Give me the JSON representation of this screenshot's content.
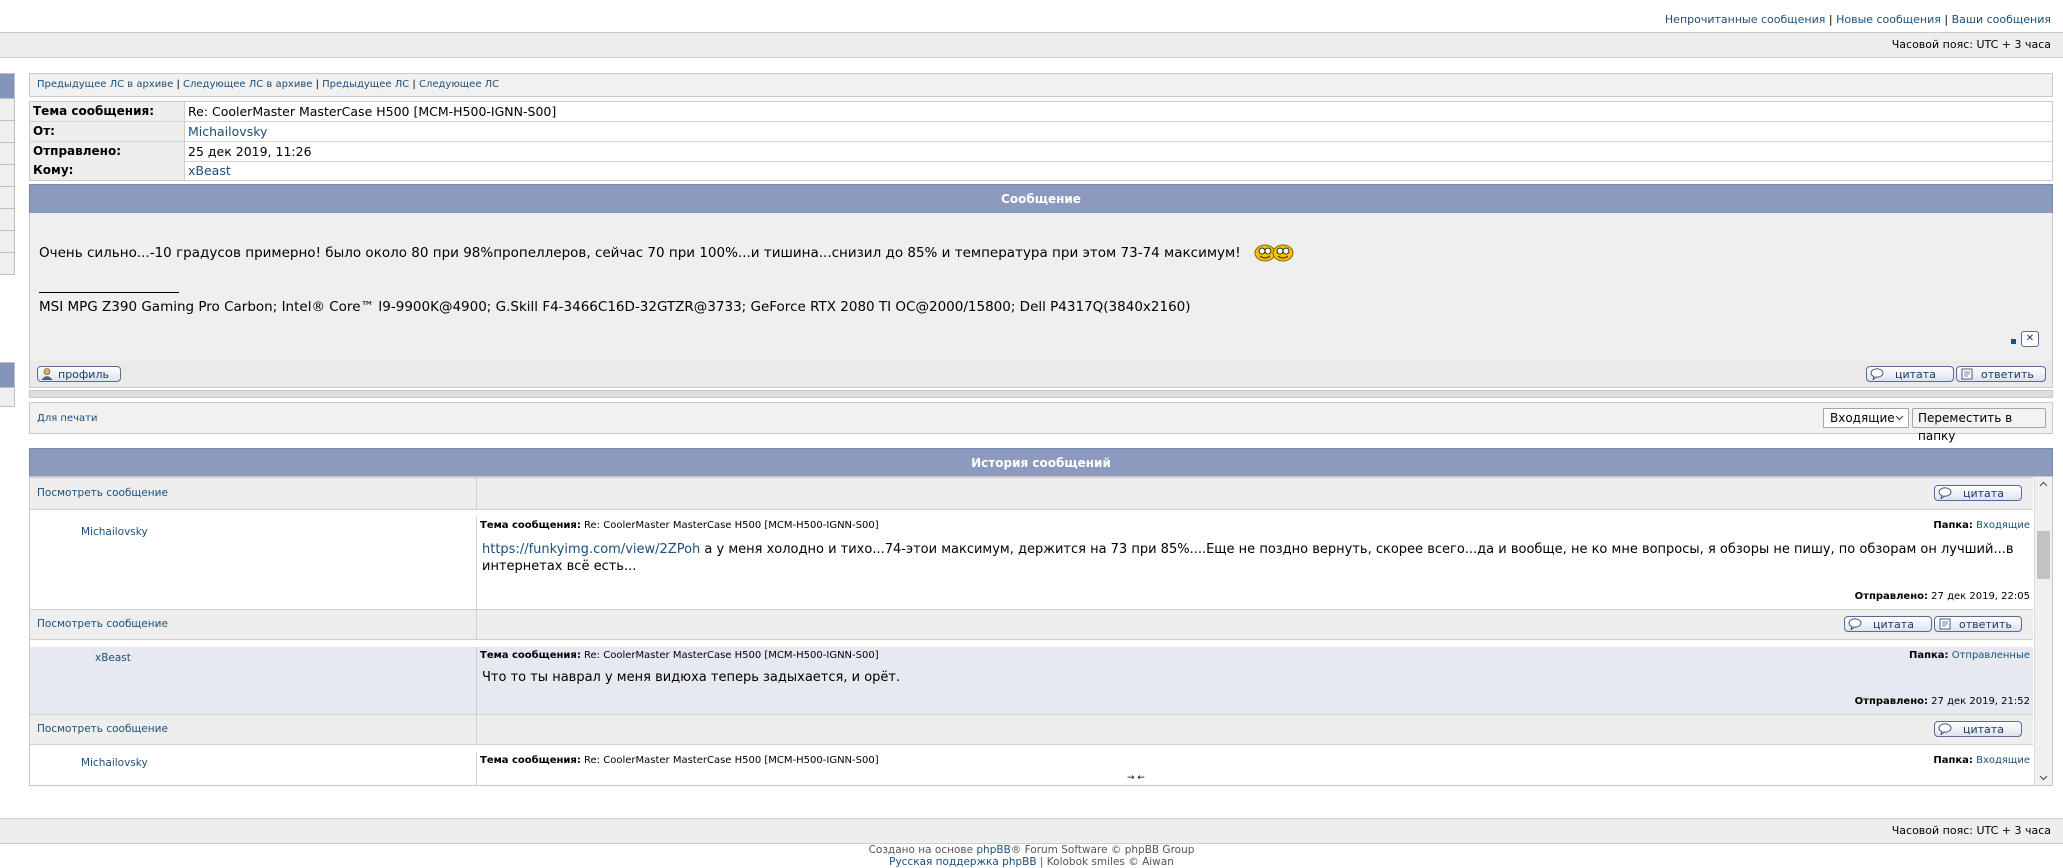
{
  "top": {
    "unread": "Непрочитанные сообщения",
    "new": "Новые сообщения",
    "yours": "Ваши сообщения",
    "sep": "|",
    "timezone": "Часовой пояс: UTC + 3 часа"
  },
  "pm_nav": {
    "prev_archive": "Предыдущее ЛС в архиве",
    "next_archive": "Следующее ЛС в архиве",
    "prev": "Предыдущее ЛС",
    "next": "Следующее ЛС",
    "sep": "|"
  },
  "header": {
    "subject_label": "Тема сообщения:",
    "subject": "Re: CoolerMaster MasterCase H500 [MCM-H500-IGNN-S00]",
    "from_label": "От:",
    "from": "Michailovsky",
    "sent_label": "Отправлено:",
    "sent": "25 дек 2019, 11:26",
    "to_label": "Кому:",
    "to": "xBeast"
  },
  "message": {
    "title": "Сообщение",
    "body": "Очень сильно...-10 градусов примерно! было около 80 при 98%пропеллеров, сейчас 70 при 100%...и тишина...снизил до 85% и температура при этом 73-74 максимум!",
    "signature": "MSI MPG Z390 Gaming Pro Carbon; Intel® Core™ I9-9900K@4900; G.Skill F4-3466C16D-32GTZR@3733; GeForce RTX 2080 TI OC@2000/15800; Dell P4317Q(3840x2160)",
    "close_glyph": "✕",
    "smiley": "laughing-smiley-icon"
  },
  "buttons": {
    "profile": "профиль",
    "quote": "цитата",
    "reply": "ответить"
  },
  "print_row": {
    "print": "Для печати",
    "folder_select": "Входящие",
    "move": "Переместить в папку"
  },
  "history": {
    "title": "История сообщений",
    "view": "Посмотреть сообщение",
    "subject_label": "Тема сообщения:",
    "folder_label": "Папка:",
    "sent_label": "Отправлено:",
    "entries": [
      {
        "author": "Michailovsky",
        "subject": "Re: CoolerMaster MasterCase H500 [MCM-H500-IGNN-S00]",
        "folder": "Входящие",
        "link": "https://funkyimg.com/view/2ZPoh",
        "body": " а у меня холодно и тихо...74-этои максимум, держится на 73 при 85%....Еще не поздно вернуть, скорее всего...да и вообще, не ко мне вопросы, я обзоры не пишу, по обзорам он лучший...в интернетах всё есть...",
        "sent": "27 дек 2019, 22:05"
      },
      {
        "author": "xBeast",
        "subject": "Re: CoolerMaster MasterCase H500 [MCM-H500-IGNN-S00]",
        "folder": "Отправленные",
        "body": "Что то ты наврал у меня видюха теперь задыхается, и орёт.",
        "sent": "27 дек 2019, 21:52"
      },
      {
        "author": "Michailovsky",
        "subject": "Re: CoolerMaster MasterCase H500 [MCM-H500-IGNN-S00]",
        "folder": "Входящие",
        "body": "→ ←"
      }
    ]
  },
  "footer": {
    "timezone": "Часовой пояс: UTC + 3 часа",
    "created_prefix": "Создано на основе ",
    "phpbb": "phpBB",
    "created_suffix": "® Forum Software © phpBB Group",
    "ru_support": "Русская поддержка phpBB",
    "sep": "|",
    "kolobok": "Kolobok smiles © Aiwan"
  },
  "icons": {
    "profile": "profile-person-icon",
    "quote": "quote-bubble-icon",
    "reply": "reply-note-icon",
    "chevron": "chevron-down-icon",
    "scroll_up": "scroll-up-icon",
    "scroll_down": "scroll-down-icon"
  }
}
